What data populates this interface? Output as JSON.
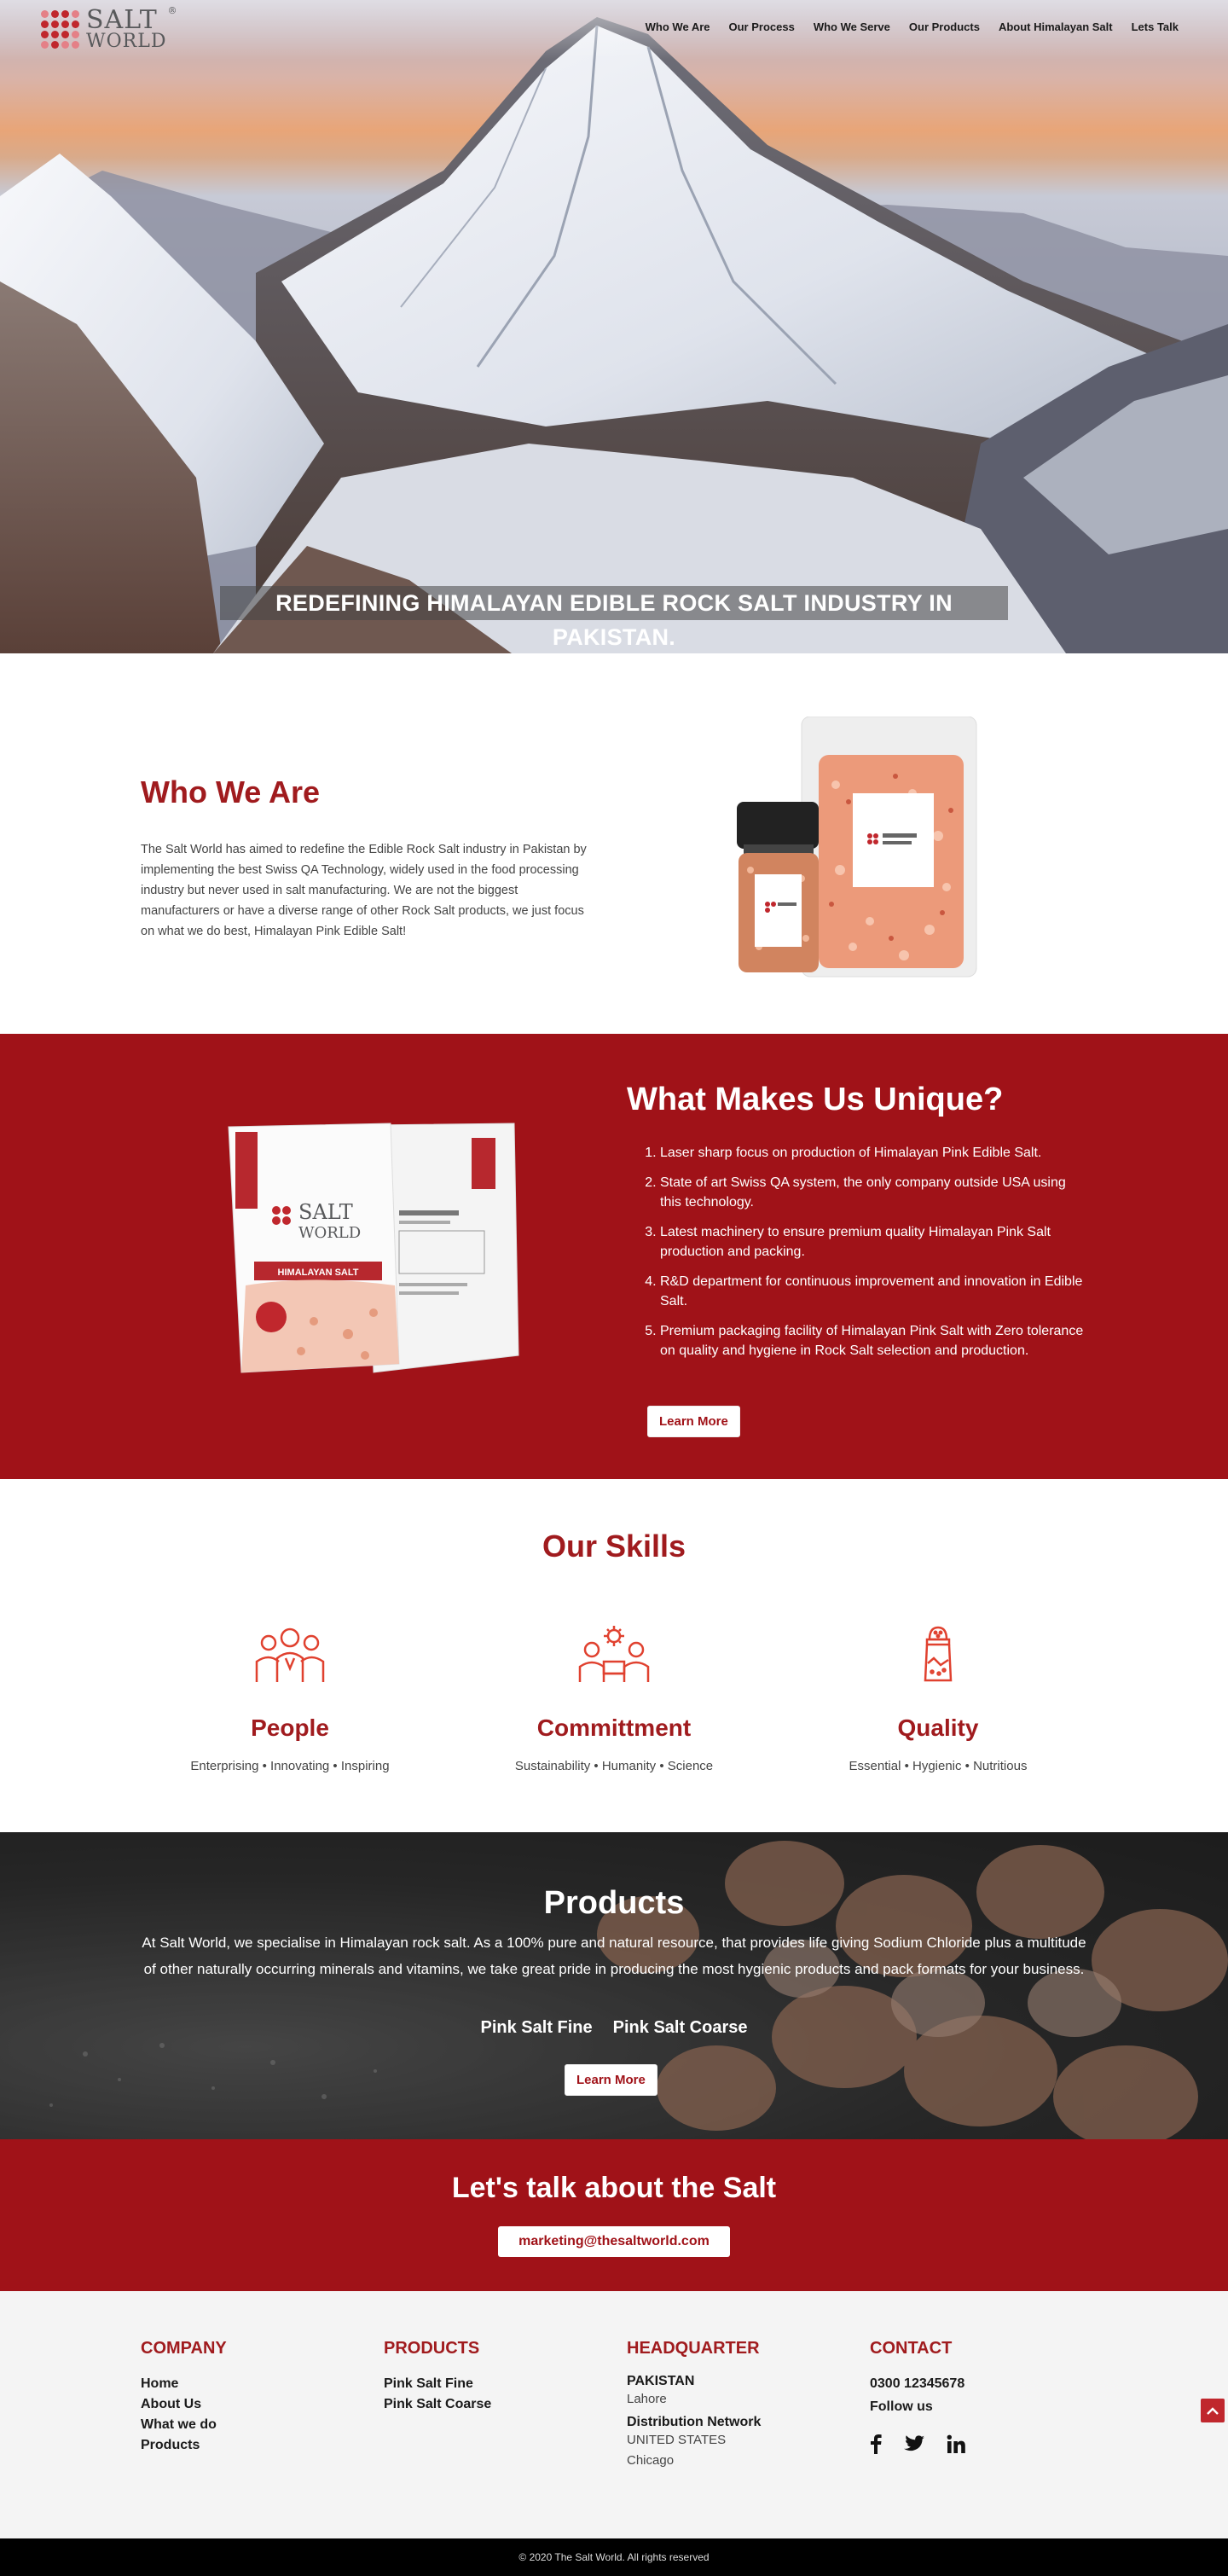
{
  "header": {
    "logo": {
      "line1": "SALT",
      "line2": "WORLD",
      "registered": "®"
    },
    "nav": [
      "Who We Are",
      "Our Process",
      "Who We Serve",
      "Our Products",
      "About Himalayan Salt",
      "Lets Talk"
    ]
  },
  "hero": {
    "caption": "REDEFINING HIMALAYAN EDIBLE ROCK SALT INDUSTRY IN PAKISTAN."
  },
  "who_we_are": {
    "title": "Who We Are",
    "body": "The Salt World has aimed to redefine the Edible Rock Salt industry in Pakistan by implementing the best Swiss QA Technology, widely used in the food processing industry but never used in salt manufacturing. We are not the biggest manufacturers or have a diverse range of other Rock Salt products, we just focus on what we do best, Himalayan Pink Edible Salt!"
  },
  "unique": {
    "title": "What Makes Us Unique?",
    "items": [
      "Laser sharp focus on production of Himalayan Pink Edible Salt.",
      "State of art Swiss QA system, the only company outside USA using this technology.",
      "Latest machinery to ensure premium quality Himalayan Pink Salt production and packing.",
      "R&D department for continuous improvement and innovation in Edible Salt.",
      "Premium packaging facility of Himalayan Pink Salt with Zero tolerance on quality and hygiene in Rock Salt selection and production."
    ],
    "button": "Learn More"
  },
  "skills": {
    "title": "Our Skills",
    "items": [
      {
        "title": "People",
        "tagline": "Enterprising • Innovating • Inspiring",
        "icon": "people-icon"
      },
      {
        "title": "Committment",
        "tagline": "Sustainability • Humanity • Science",
        "icon": "gear-team-icon"
      },
      {
        "title": "Quality",
        "tagline": "Essential • Hygienic • Nutritious",
        "icon": "salt-shaker-icon"
      }
    ]
  },
  "products": {
    "title": "Products",
    "body": "At Salt World, we specialise in Himalayan rock salt. As a 100% pure and natural resource, that provides life giving Sodium Chloride plus a multitude of other naturally occurring minerals and vitamins, we take great pride in producing the most hygienic products and pack formats for your business.",
    "links": [
      "Pink Salt Fine",
      "Pink Salt Coarse"
    ],
    "button": "Learn More"
  },
  "talk": {
    "title": "Let's talk about the Salt",
    "email": "marketing@thesaltworld.com"
  },
  "footer": {
    "company": {
      "title": "COMPANY",
      "links": [
        "Home",
        "About Us",
        "What we do",
        "Products"
      ]
    },
    "products": {
      "title": "PRODUCTS",
      "links": [
        "Pink Salt Fine",
        "Pink Salt Coarse"
      ]
    },
    "headquarter": {
      "title": "HEADQUARTER",
      "country": "PAKISTAN",
      "city": "Lahore",
      "network_title": "Distribution Network",
      "network_country": "UNITED STATES",
      "network_city": "Chicago"
    },
    "contact": {
      "title": "CONTACT",
      "phone": "0300 12345678",
      "follow": "Follow us",
      "social": [
        "facebook-icon",
        "twitter-icon",
        "linkedin-icon"
      ]
    },
    "copyright": "© 2020 The Salt World. All rights reserved"
  },
  "colors": {
    "brand_red": "#a01218",
    "accent_red": "#c0272d"
  }
}
